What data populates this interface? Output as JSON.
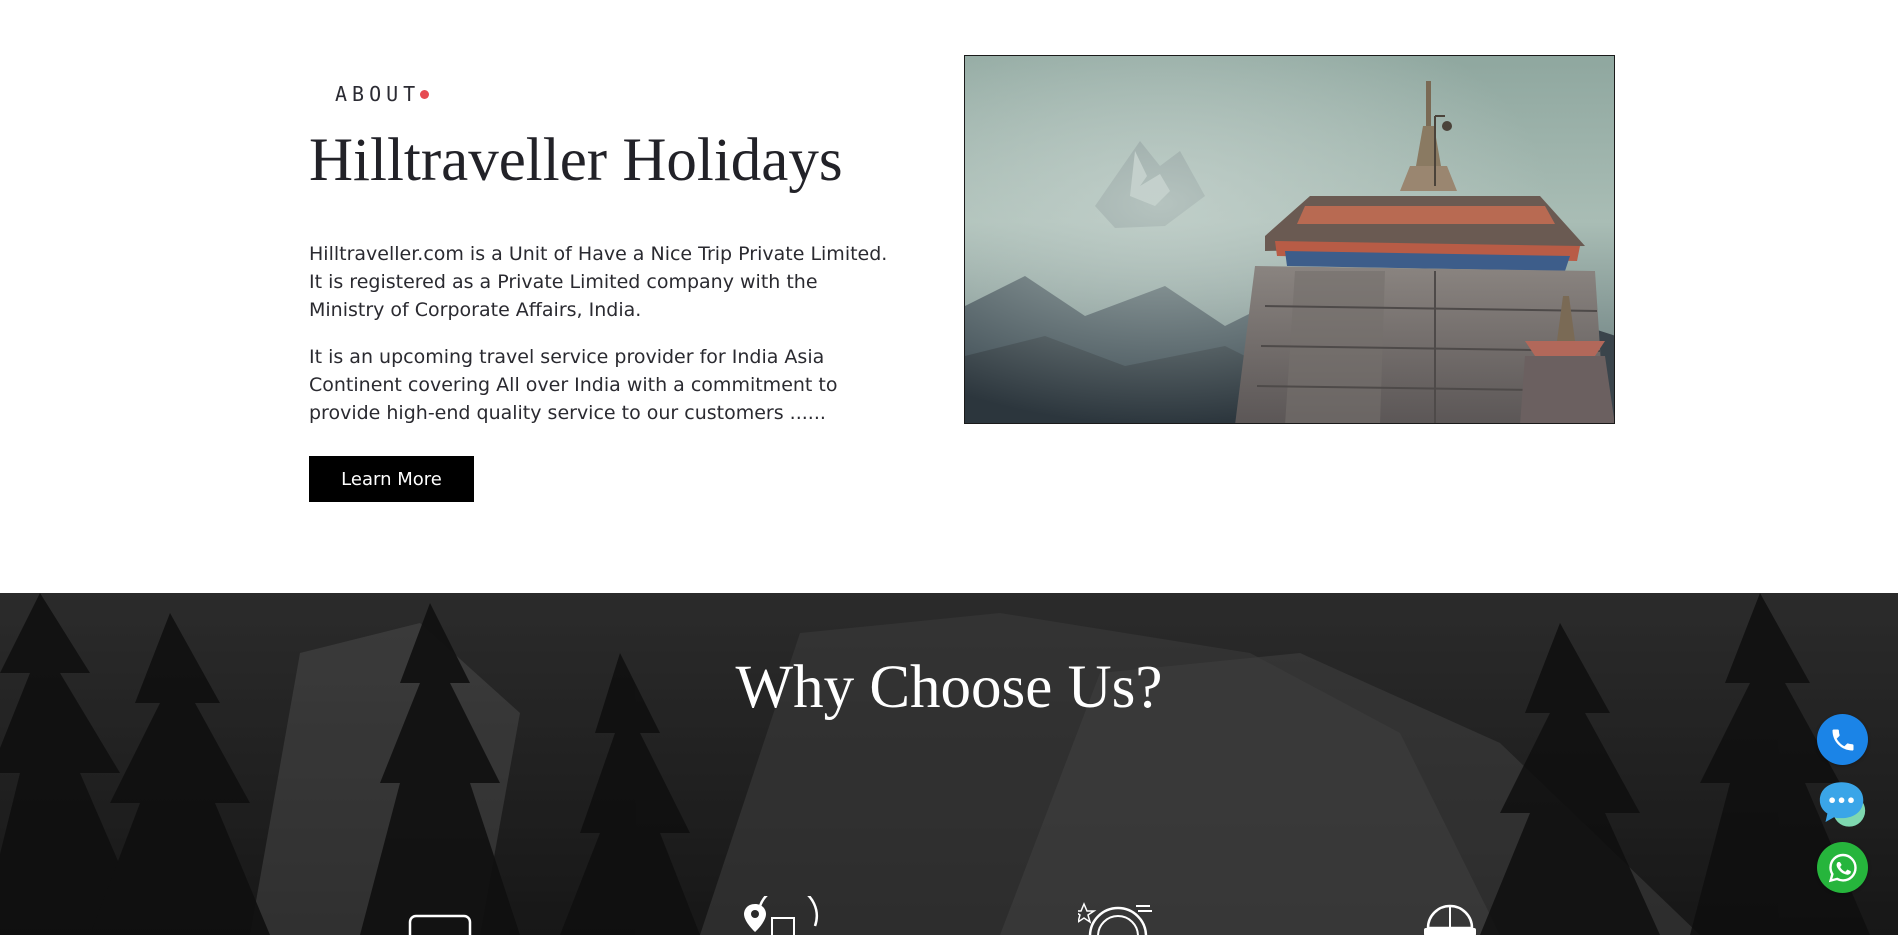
{
  "about": {
    "eyebrow": "ABOUT",
    "title": "Hilltraveller Holidays",
    "paragraph_1": "Hilltraveller.com is a Unit of Have a Nice Trip Private Limited. It is registered as a Private Limited company with the Ministry of Corporate Affairs, India.",
    "paragraph_2": "It is an upcoming travel service provider for India Asia Continent covering All over India with a commitment to provide high-end quality service to our customers ......",
    "button_label": "Learn More",
    "image_icon": "temple-mountain-photo"
  },
  "why_choose": {
    "title": "Why Choose Us?",
    "icons": [
      "bus-icon",
      "map-pin-hotel-icon",
      "award-badge-icon",
      "safety-helmet-icon"
    ]
  },
  "floating": {
    "call_icon": "phone-icon",
    "chat_icon": "chat-icon",
    "whatsapp_icon": "whatsapp-icon"
  },
  "colors": {
    "accent_dot": "#e64b52",
    "button_bg": "#000000",
    "call_blue": "#1b84e7",
    "whatsapp_green": "#26b53c"
  }
}
